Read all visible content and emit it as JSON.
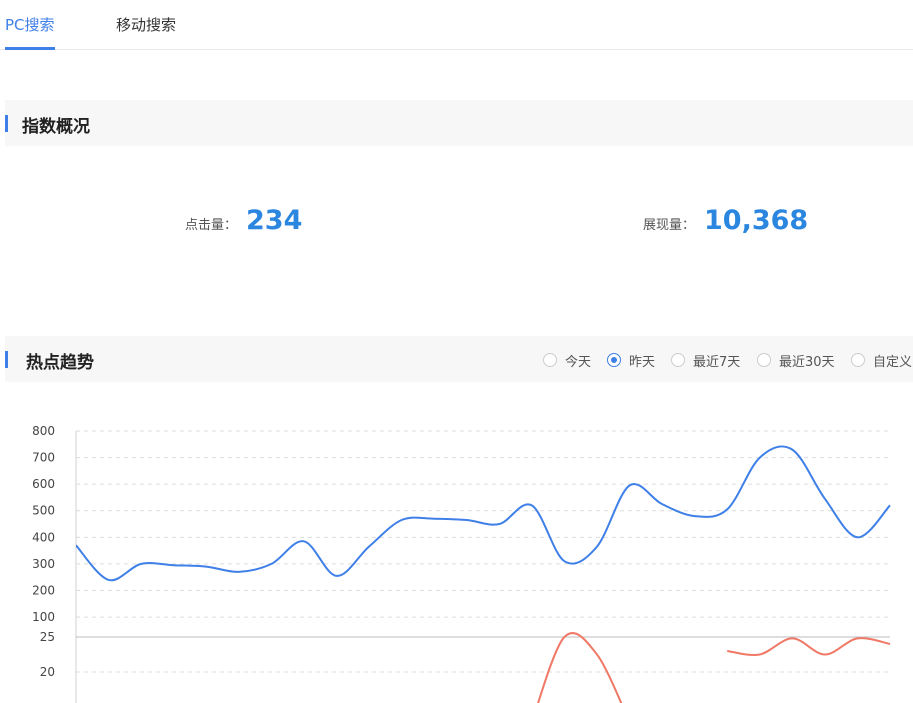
{
  "tabs": [
    {
      "label": "PC搜索",
      "active": true
    },
    {
      "label": "移动搜索",
      "active": false
    }
  ],
  "overview": {
    "title": "指数概况",
    "clicks_label": "点击量：",
    "clicks_value": "234",
    "impressions_label": "展现量：",
    "impressions_value": "10,368"
  },
  "trend": {
    "title": "热点趋势",
    "ranges": [
      {
        "label": "今天",
        "selected": false
      },
      {
        "label": "昨天",
        "selected": true
      },
      {
        "label": "最近7天",
        "selected": false
      },
      {
        "label": "最近30天",
        "selected": false
      },
      {
        "label": "自定义",
        "selected": false
      }
    ]
  },
  "colors": {
    "accent": "#3f7fe8",
    "value": "#2b86e0",
    "series_impressions": "#3f7fe8",
    "series_clicks": "#f07866"
  },
  "chart_data": {
    "type": "line",
    "upper_axis": {
      "ticks": [
        "800",
        "700",
        "600",
        "500",
        "400",
        "300",
        "200",
        "100"
      ],
      "range": [
        25,
        800
      ]
    },
    "lower_axis": {
      "ticks": [
        "25",
        "20"
      ]
    },
    "grid": true,
    "series": [
      {
        "key": "impressions",
        "values": [
          370,
          240,
          300,
          295,
          290,
          270,
          300,
          385,
          255,
          365,
          465,
          470,
          465,
          450,
          520,
          310,
          365,
          595,
          525,
          480,
          505,
          700,
          730,
          545,
          400,
          520
        ]
      },
      {
        "key": "clicks",
        "values": [
          null,
          null,
          null,
          null,
          null,
          null,
          null,
          null,
          null,
          null,
          null,
          null,
          null,
          null,
          10,
          25,
          22.5,
          10,
          null,
          null,
          23,
          22.5,
          24.8,
          22.5,
          24.8,
          24
        ]
      }
    ]
  }
}
